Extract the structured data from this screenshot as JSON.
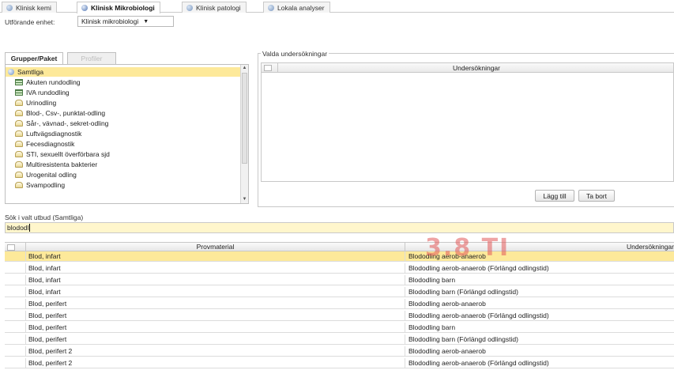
{
  "tabs": [
    {
      "label": "Klinisk kemi",
      "active": false
    },
    {
      "label": "Klinisk Mikrobiologi",
      "active": true
    },
    {
      "label": "Klinisk patologi",
      "active": false
    },
    {
      "label": "Lokala analyser",
      "active": false
    }
  ],
  "unit": {
    "label": "Utförande enhet:",
    "value": "Klinisk mikrobiologi"
  },
  "groups": {
    "tab_active": "Grupper/Paket",
    "tab_inactive": "Profiler",
    "items": [
      {
        "label": "Samtliga",
        "icon": "globe-icon",
        "selected": true
      },
      {
        "label": "Akuten rundodling",
        "icon": "table-icon"
      },
      {
        "label": "IVA rundodling",
        "icon": "table-icon"
      },
      {
        "label": "Urinodling",
        "icon": "package-icon"
      },
      {
        "label": "Blod-, Csv-, punktat-odling",
        "icon": "package-icon"
      },
      {
        "label": "Sår-, vävnad-, sekret-odling",
        "icon": "package-icon"
      },
      {
        "label": "Luftvägsdiagnostik",
        "icon": "package-icon"
      },
      {
        "label": "Fecesdiagnostik",
        "icon": "package-icon"
      },
      {
        "label": "STI, sexuellt överförbara sjd",
        "icon": "package-icon"
      },
      {
        "label": "Multiresistenta bakterier",
        "icon": "package-icon"
      },
      {
        "label": "Urogenital odling",
        "icon": "package-icon"
      },
      {
        "label": "Svampodling",
        "icon": "package-icon"
      }
    ]
  },
  "selected_tests": {
    "legend": "Valda undersökningar",
    "column": "Undersökningar",
    "add_label": "Lägg till",
    "remove_label": "Ta bort"
  },
  "search": {
    "label": "Sök i valt utbud (Samtliga)",
    "value": "blododl"
  },
  "results": {
    "col_material": "Provmaterial",
    "col_test": "Undersökningar",
    "rows": [
      {
        "material": "Blod, infart",
        "test": "Blododling aerob-anaerob",
        "selected": true
      },
      {
        "material": "Blod, infart",
        "test": "Blododling aerob-anaerob (Förlängd odlingstid)"
      },
      {
        "material": "Blod, infart",
        "test": "Blododling barn"
      },
      {
        "material": "Blod, infart",
        "test": "Blododling barn (Förlängd odlingstid)"
      },
      {
        "material": "Blod, perifert",
        "test": "Blododling aerob-anaerob"
      },
      {
        "material": "Blod, perifert",
        "test": "Blododling aerob-anaerob (Förlängd odlingstid)"
      },
      {
        "material": "Blod, perifert",
        "test": "Blododling barn"
      },
      {
        "material": "Blod, perifert",
        "test": "Blododling barn (Förlängd odlingstid)"
      },
      {
        "material": "Blod, perifert 2",
        "test": "Blododling aerob-anaerob"
      },
      {
        "material": "Blod, perifert 2",
        "test": "Blododling aerob-anaerob (Förlängd odlingstid)"
      }
    ]
  },
  "watermark": "3.8 TI"
}
